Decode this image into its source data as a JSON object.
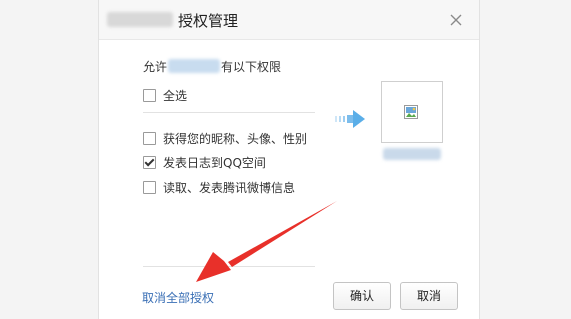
{
  "dialog": {
    "title": "授权管理",
    "allow_prefix": "允许",
    "allow_suffix": "有以下权限",
    "select_all": "全选",
    "permissions": [
      {
        "label": "获得您的昵称、头像、性别",
        "checked": false
      },
      {
        "label": "发表日志到QQ空间",
        "checked": true
      },
      {
        "label": "读取、发表腾讯微博信息",
        "checked": false
      }
    ],
    "revoke_link": "取消全部授权",
    "confirm_button": "确认",
    "cancel_button": "取消"
  },
  "icons": {
    "close": "close-icon",
    "transfer_arrow": "arrow-right-icon",
    "broken_image": "broken-image-icon",
    "annotation": "red-pointer-arrow"
  },
  "colors": {
    "link": "#3a6fb5",
    "annotation_arrow": "#e8302a",
    "transfer_arrow": "#5aaee8"
  }
}
